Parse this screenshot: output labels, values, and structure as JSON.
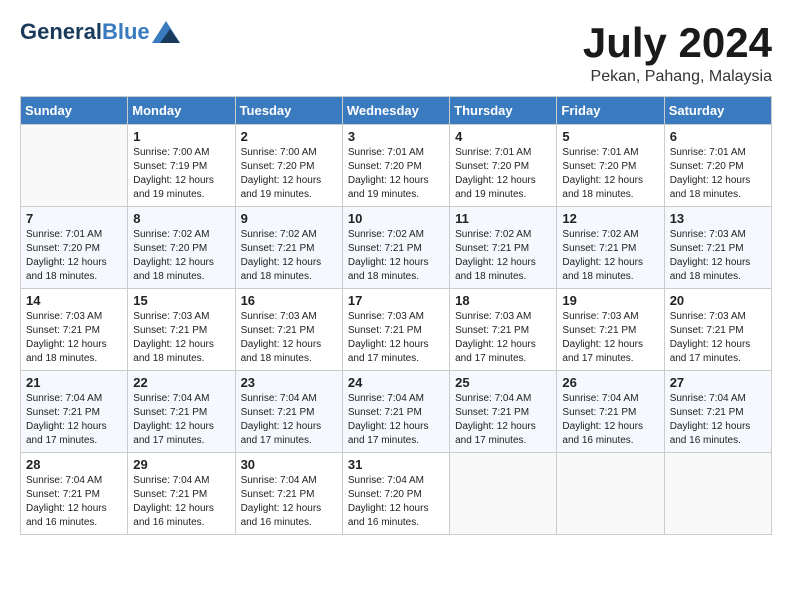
{
  "header": {
    "logo_line1": "General",
    "logo_line2": "Blue",
    "month_year": "July 2024",
    "location": "Pekan, Pahang, Malaysia"
  },
  "weekdays": [
    "Sunday",
    "Monday",
    "Tuesday",
    "Wednesday",
    "Thursday",
    "Friday",
    "Saturday"
  ],
  "weeks": [
    [
      {
        "day": "",
        "info": ""
      },
      {
        "day": "1",
        "info": "Sunrise: 7:00 AM\nSunset: 7:19 PM\nDaylight: 12 hours\nand 19 minutes."
      },
      {
        "day": "2",
        "info": "Sunrise: 7:00 AM\nSunset: 7:20 PM\nDaylight: 12 hours\nand 19 minutes."
      },
      {
        "day": "3",
        "info": "Sunrise: 7:01 AM\nSunset: 7:20 PM\nDaylight: 12 hours\nand 19 minutes."
      },
      {
        "day": "4",
        "info": "Sunrise: 7:01 AM\nSunset: 7:20 PM\nDaylight: 12 hours\nand 19 minutes."
      },
      {
        "day": "5",
        "info": "Sunrise: 7:01 AM\nSunset: 7:20 PM\nDaylight: 12 hours\nand 18 minutes."
      },
      {
        "day": "6",
        "info": "Sunrise: 7:01 AM\nSunset: 7:20 PM\nDaylight: 12 hours\nand 18 minutes."
      }
    ],
    [
      {
        "day": "7",
        "info": "Sunrise: 7:01 AM\nSunset: 7:20 PM\nDaylight: 12 hours\nand 18 minutes."
      },
      {
        "day": "8",
        "info": "Sunrise: 7:02 AM\nSunset: 7:20 PM\nDaylight: 12 hours\nand 18 minutes."
      },
      {
        "day": "9",
        "info": "Sunrise: 7:02 AM\nSunset: 7:21 PM\nDaylight: 12 hours\nand 18 minutes."
      },
      {
        "day": "10",
        "info": "Sunrise: 7:02 AM\nSunset: 7:21 PM\nDaylight: 12 hours\nand 18 minutes."
      },
      {
        "day": "11",
        "info": "Sunrise: 7:02 AM\nSunset: 7:21 PM\nDaylight: 12 hours\nand 18 minutes."
      },
      {
        "day": "12",
        "info": "Sunrise: 7:02 AM\nSunset: 7:21 PM\nDaylight: 12 hours\nand 18 minutes."
      },
      {
        "day": "13",
        "info": "Sunrise: 7:03 AM\nSunset: 7:21 PM\nDaylight: 12 hours\nand 18 minutes."
      }
    ],
    [
      {
        "day": "14",
        "info": "Sunrise: 7:03 AM\nSunset: 7:21 PM\nDaylight: 12 hours\nand 18 minutes."
      },
      {
        "day": "15",
        "info": "Sunrise: 7:03 AM\nSunset: 7:21 PM\nDaylight: 12 hours\nand 18 minutes."
      },
      {
        "day": "16",
        "info": "Sunrise: 7:03 AM\nSunset: 7:21 PM\nDaylight: 12 hours\nand 18 minutes."
      },
      {
        "day": "17",
        "info": "Sunrise: 7:03 AM\nSunset: 7:21 PM\nDaylight: 12 hours\nand 17 minutes."
      },
      {
        "day": "18",
        "info": "Sunrise: 7:03 AM\nSunset: 7:21 PM\nDaylight: 12 hours\nand 17 minutes."
      },
      {
        "day": "19",
        "info": "Sunrise: 7:03 AM\nSunset: 7:21 PM\nDaylight: 12 hours\nand 17 minutes."
      },
      {
        "day": "20",
        "info": "Sunrise: 7:03 AM\nSunset: 7:21 PM\nDaylight: 12 hours\nand 17 minutes."
      }
    ],
    [
      {
        "day": "21",
        "info": "Sunrise: 7:04 AM\nSunset: 7:21 PM\nDaylight: 12 hours\nand 17 minutes."
      },
      {
        "day": "22",
        "info": "Sunrise: 7:04 AM\nSunset: 7:21 PM\nDaylight: 12 hours\nand 17 minutes."
      },
      {
        "day": "23",
        "info": "Sunrise: 7:04 AM\nSunset: 7:21 PM\nDaylight: 12 hours\nand 17 minutes."
      },
      {
        "day": "24",
        "info": "Sunrise: 7:04 AM\nSunset: 7:21 PM\nDaylight: 12 hours\nand 17 minutes."
      },
      {
        "day": "25",
        "info": "Sunrise: 7:04 AM\nSunset: 7:21 PM\nDaylight: 12 hours\nand 17 minutes."
      },
      {
        "day": "26",
        "info": "Sunrise: 7:04 AM\nSunset: 7:21 PM\nDaylight: 12 hours\nand 16 minutes."
      },
      {
        "day": "27",
        "info": "Sunrise: 7:04 AM\nSunset: 7:21 PM\nDaylight: 12 hours\nand 16 minutes."
      }
    ],
    [
      {
        "day": "28",
        "info": "Sunrise: 7:04 AM\nSunset: 7:21 PM\nDaylight: 12 hours\nand 16 minutes."
      },
      {
        "day": "29",
        "info": "Sunrise: 7:04 AM\nSunset: 7:21 PM\nDaylight: 12 hours\nand 16 minutes."
      },
      {
        "day": "30",
        "info": "Sunrise: 7:04 AM\nSunset: 7:21 PM\nDaylight: 12 hours\nand 16 minutes."
      },
      {
        "day": "31",
        "info": "Sunrise: 7:04 AM\nSunset: 7:20 PM\nDaylight: 12 hours\nand 16 minutes."
      },
      {
        "day": "",
        "info": ""
      },
      {
        "day": "",
        "info": ""
      },
      {
        "day": "",
        "info": ""
      }
    ]
  ]
}
